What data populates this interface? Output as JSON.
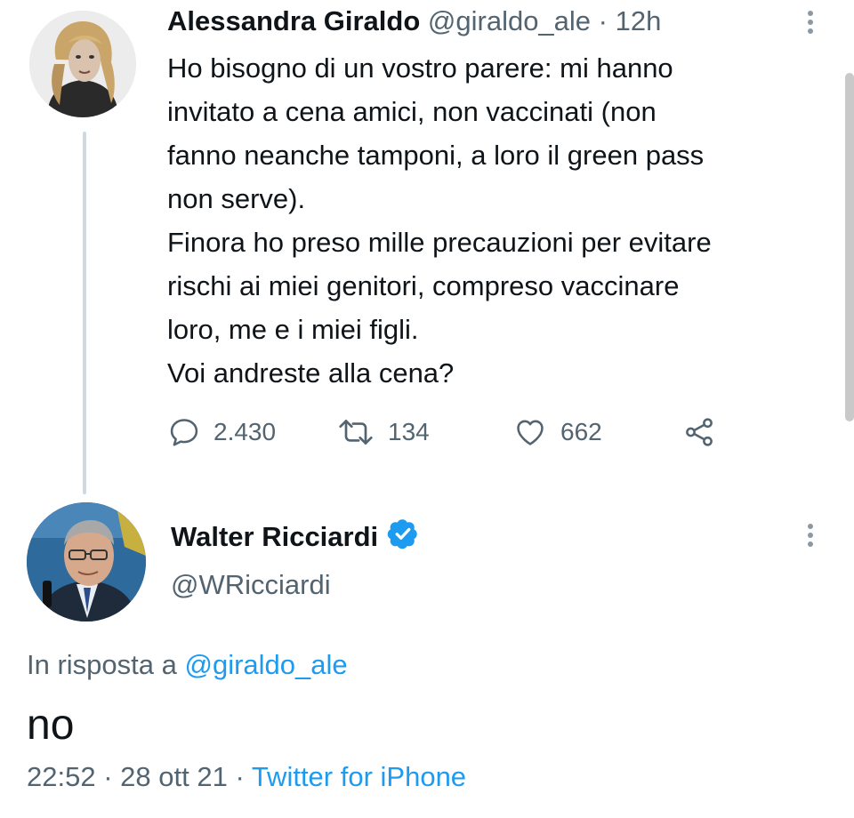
{
  "original_tweet": {
    "author_name": "Alessandra Giraldo",
    "handle": "@giraldo_ale",
    "separator": "·",
    "age": "12h",
    "body_lines": [
      "Ho bisogno di un vostro parere: mi hanno",
      "invitato a cena amici, non vaccinati (non",
      "fanno neanche tamponi, a loro il green pass",
      "non serve).",
      "Finora ho preso mille precauzioni per evitare",
      "rischi ai miei genitori, compreso vaccinare",
      "loro, me e i miei figli.",
      "Voi andreste alla cena?"
    ],
    "actions": {
      "replies": "2.430",
      "retweets": "134",
      "likes": "662"
    }
  },
  "reply_tweet": {
    "author_name": "Walter Ricciardi",
    "handle": "@WRicciardi",
    "in_reply_prefix": "In risposta a",
    "in_reply_handle": "@giraldo_ale",
    "body": "no",
    "time": "22:52",
    "separator": "·",
    "date": "28 ott 21",
    "source": "Twitter for iPhone"
  },
  "icons": {
    "reply": "reply-icon",
    "retweet": "retweet-icon",
    "like": "heart-icon",
    "share": "share-icon",
    "more": "more-vertical-icon",
    "verified": "verified-badge-icon"
  },
  "colors": {
    "text_primary": "#0f1419",
    "text_secondary": "#536471",
    "link": "#1d9bf0",
    "thread_line": "#cfd9de"
  }
}
